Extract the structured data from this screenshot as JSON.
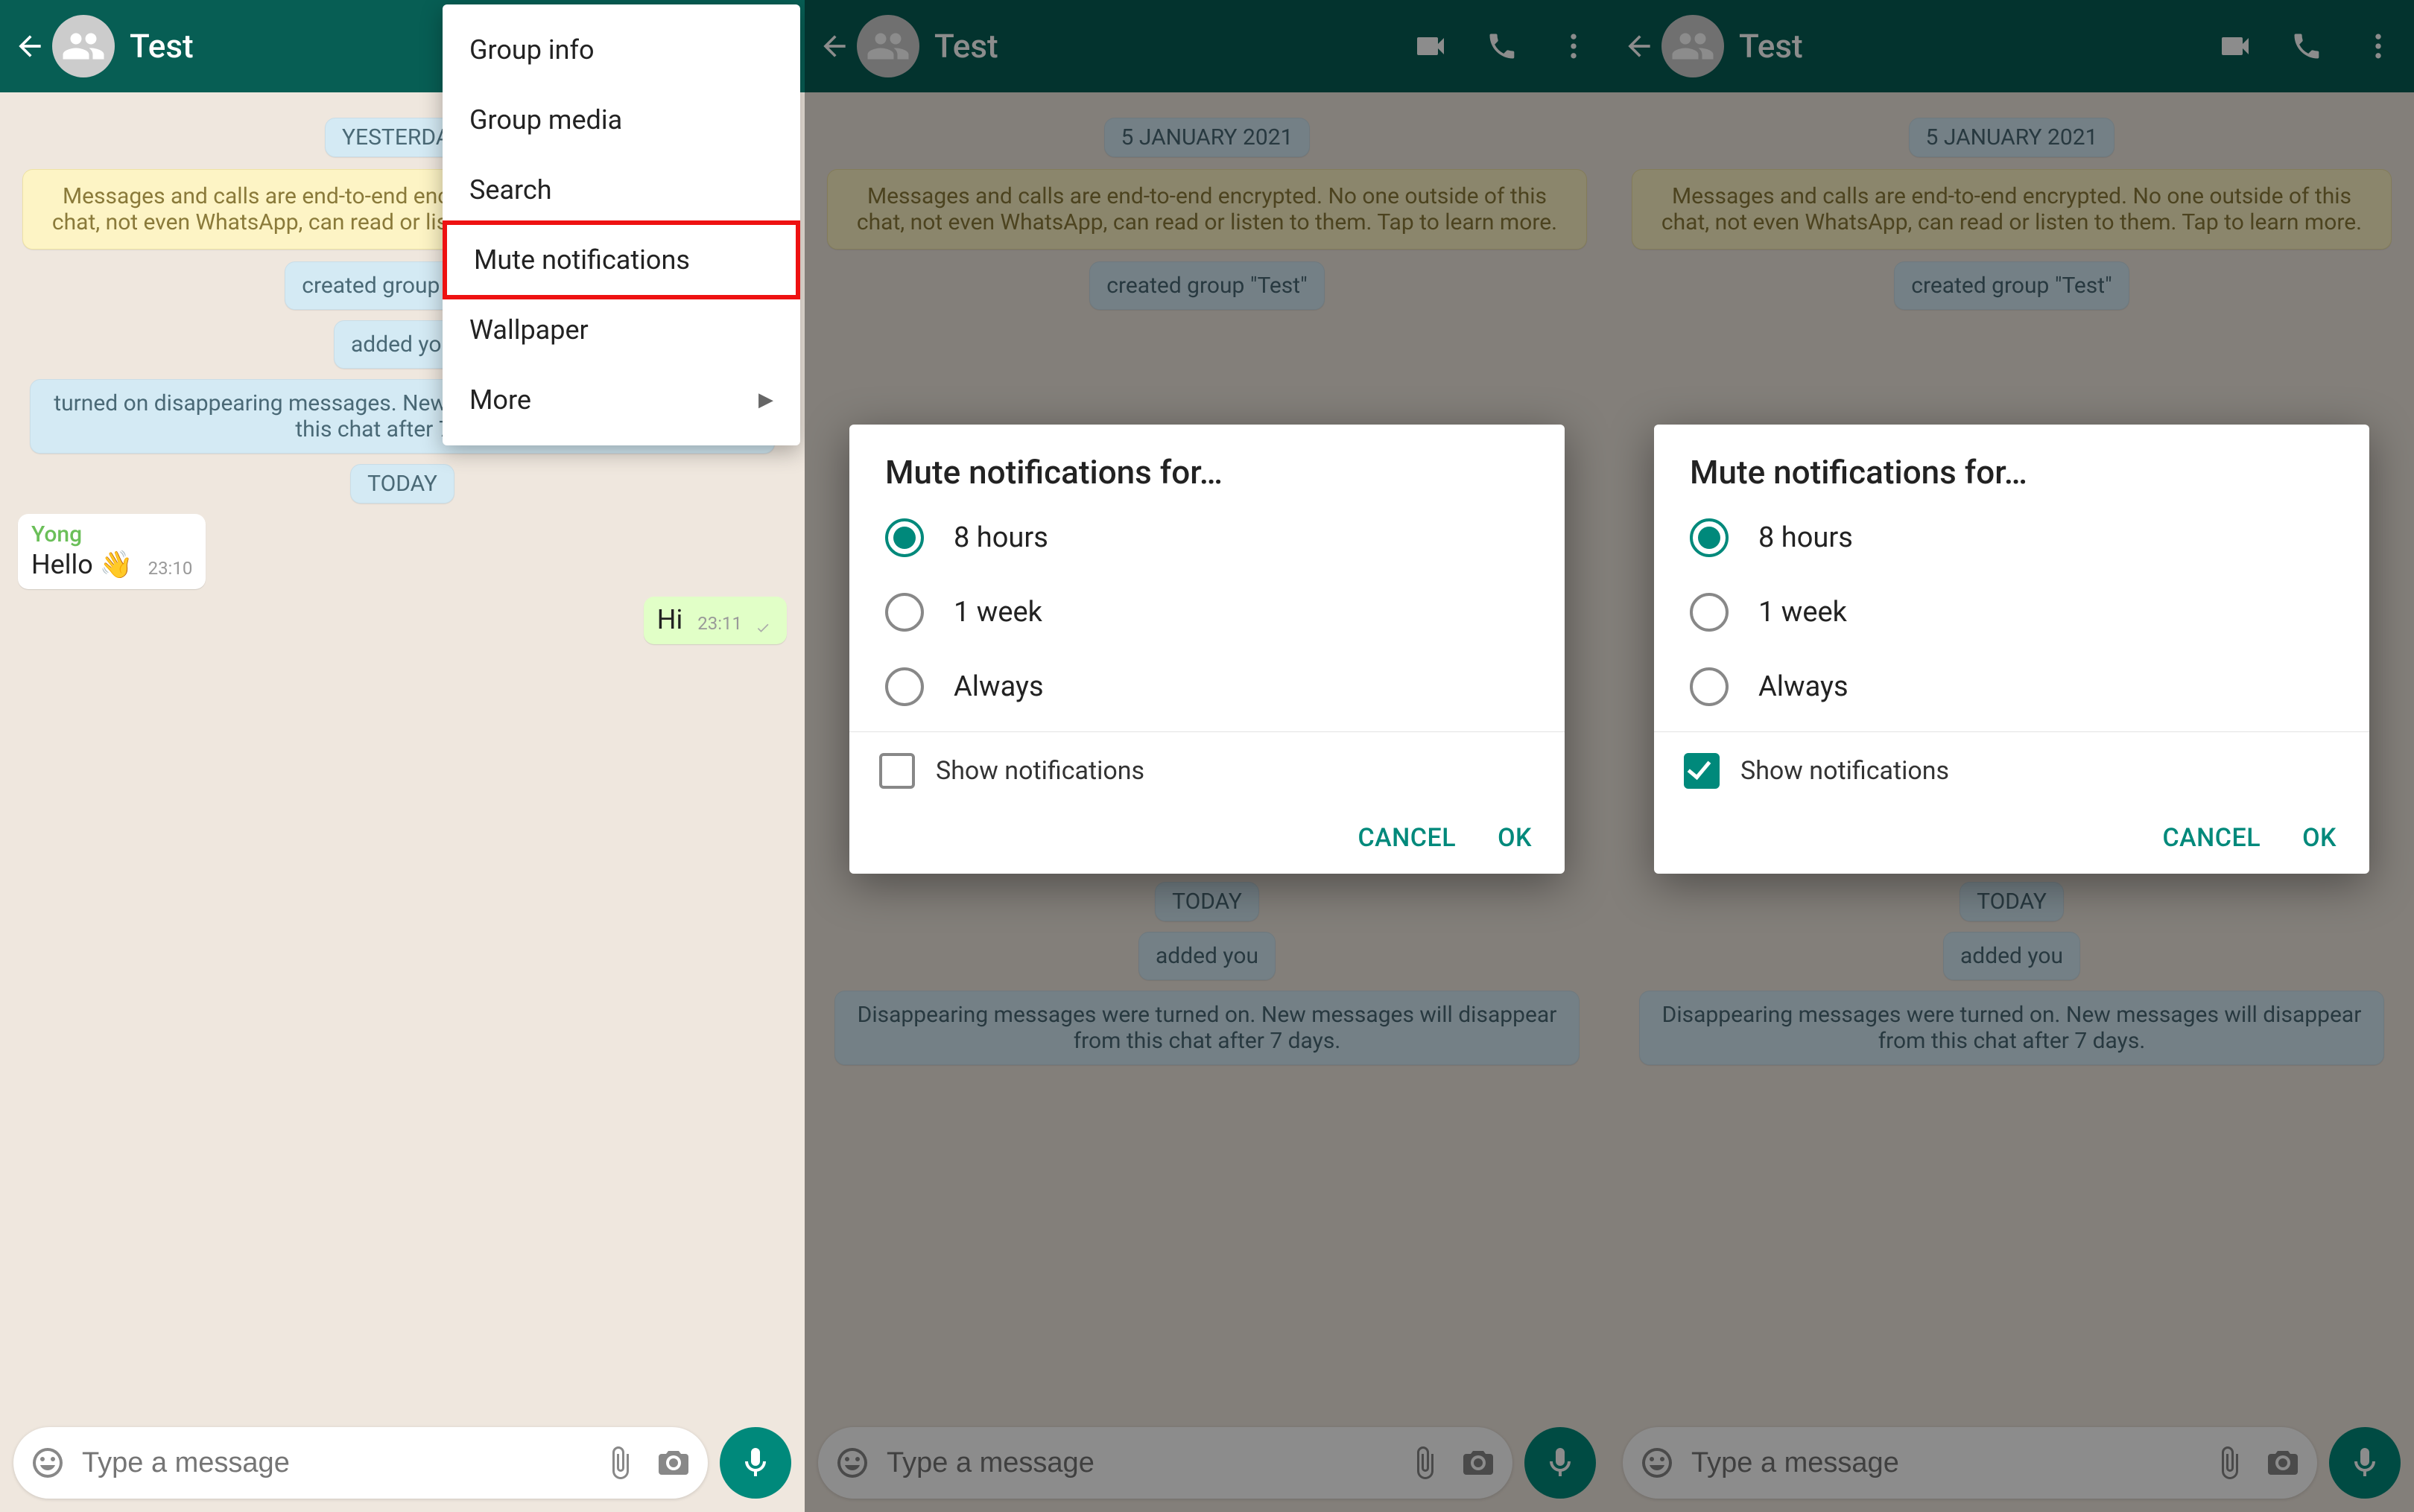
{
  "header": {
    "title": "Test"
  },
  "menu": {
    "items": [
      {
        "label": "Group info"
      },
      {
        "label": "Group media"
      },
      {
        "label": "Search"
      },
      {
        "label": "Mute notifications",
        "highlighted": true
      },
      {
        "label": "Wallpaper"
      },
      {
        "label": "More",
        "submenu": true
      }
    ]
  },
  "chatA": {
    "date_pill_1": "YESTERDAY",
    "encryption": "Messages and calls are end-to-end encrypted. No one outside of this chat, not even WhatsApp, can read or listen to them. Tap to learn more.",
    "sys1": "created group \"Test\"",
    "sys2": "added you",
    "sys3": "turned on disappearing messages. New messages will disappear from this chat after 7 days.",
    "date_pill_2": "TODAY",
    "msg_in": {
      "sender": "Yong",
      "text": "Hello 👋",
      "time": "23:10"
    },
    "msg_out": {
      "text": "Hi",
      "time": "23:11"
    }
  },
  "chatB": {
    "date_pill_1": "5 JANUARY 2021",
    "sys1": "created group \"Test\"",
    "date_pill_2": "TODAY",
    "sys2": "added you",
    "sys3": "Disappearing messages were turned on. New messages will disappear from this chat after 7 days."
  },
  "dialog": {
    "title": "Mute notifications for…",
    "options": [
      {
        "label": "8 hours",
        "selected": true
      },
      {
        "label": "1 week",
        "selected": false
      },
      {
        "label": "Always",
        "selected": false
      }
    ],
    "show_label": "Show notifications",
    "cancel": "CANCEL",
    "ok": "OK"
  },
  "input": {
    "placeholder": "Type a message"
  }
}
